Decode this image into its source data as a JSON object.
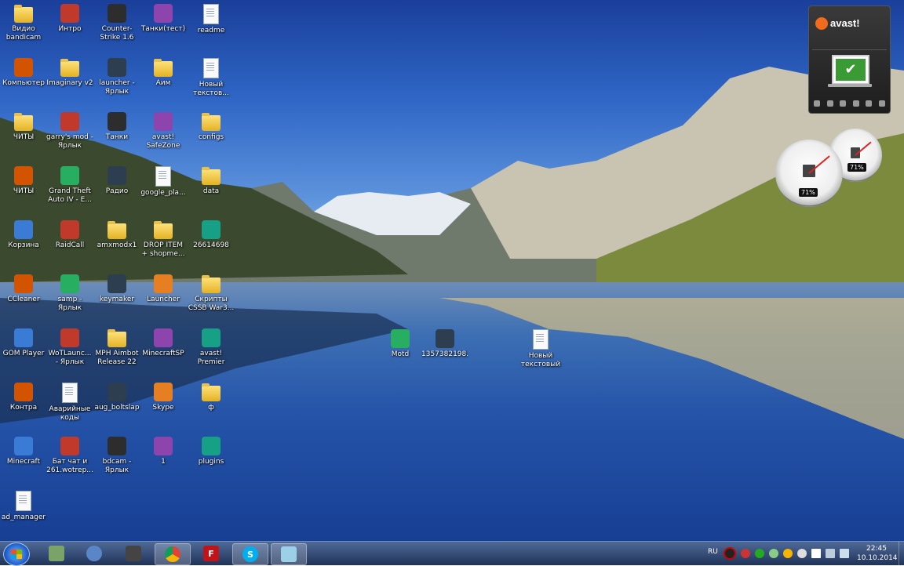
{
  "desktop_icons": [
    {
      "label": "Видио bandicam",
      "type": "folder"
    },
    {
      "label": "Интро",
      "type": "app"
    },
    {
      "label": "Counter-Strike 1.6",
      "type": "app"
    },
    {
      "label": "Танки(тест)",
      "type": "app"
    },
    {
      "label": "readme",
      "type": "doc"
    },
    {
      "label": "Компьютер",
      "type": "app"
    },
    {
      "label": "Imaginary v2",
      "type": "folder"
    },
    {
      "label": "launcher - Ярлык",
      "type": "app"
    },
    {
      "label": "Аим",
      "type": "folder"
    },
    {
      "label": "Новый текстов...",
      "type": "doc"
    },
    {
      "label": "ЧИТЫ",
      "type": "folder"
    },
    {
      "label": "garry's mod - Ярлык",
      "type": "app"
    },
    {
      "label": "Танки",
      "type": "app"
    },
    {
      "label": "avast! SafeZone",
      "type": "app"
    },
    {
      "label": "configs",
      "type": "folder"
    },
    {
      "label": "ЧИТЫ",
      "type": "app"
    },
    {
      "label": "Grand Theft Auto IV - E...",
      "type": "app"
    },
    {
      "label": "Радио",
      "type": "app"
    },
    {
      "label": "google_pla...",
      "type": "doc"
    },
    {
      "label": "data",
      "type": "folder"
    },
    {
      "label": "Корзина",
      "type": "app"
    },
    {
      "label": "RaidCall",
      "type": "app"
    },
    {
      "label": "amxmodx1",
      "type": "folder"
    },
    {
      "label": "DROP ITEM + shopme...",
      "type": "folder"
    },
    {
      "label": "26614698",
      "type": "app"
    },
    {
      "label": "CCleaner",
      "type": "app"
    },
    {
      "label": "samp - Ярлык",
      "type": "app"
    },
    {
      "label": "keymaker",
      "type": "app"
    },
    {
      "label": "Launcher",
      "type": "app"
    },
    {
      "label": "Скрипты CSSB War3...",
      "type": "folder"
    },
    {
      "label": "GOM Player",
      "type": "app"
    },
    {
      "label": "WoTLaunc... - Ярлык",
      "type": "app"
    },
    {
      "label": "MPH Aimbot Release 22",
      "type": "folder"
    },
    {
      "label": "MinecraftSP",
      "type": "app"
    },
    {
      "label": "avast! Premier",
      "type": "app"
    },
    {
      "label": "Контра",
      "type": "app"
    },
    {
      "label": "Аварийные коды",
      "type": "doc"
    },
    {
      "label": "aug_boltslap",
      "type": "app"
    },
    {
      "label": "Skype",
      "type": "app"
    },
    {
      "label": "ф",
      "type": "folder"
    },
    {
      "label": "Minecraft",
      "type": "app"
    },
    {
      "label": "Бат чат и 261.wotrep...",
      "type": "app"
    },
    {
      "label": "bdcam - Ярлык",
      "type": "app"
    },
    {
      "label": "1",
      "type": "app"
    },
    {
      "label": "plugins",
      "type": "app"
    },
    {
      "label": "ad_manager",
      "type": "doc"
    },
    {
      "label": "Motd",
      "type": "app"
    },
    {
      "label": "1357382198...",
      "type": "app"
    },
    {
      "label": "Новый текстовый ...",
      "type": "doc"
    }
  ],
  "avast_widget": {
    "brand": "avast!",
    "status_icon": "checkmark-icon"
  },
  "gauges": [
    {
      "value": "71%"
    },
    {
      "value": "71%"
    }
  ],
  "taskbar": {
    "items": [
      "start-button",
      "explorer",
      "speakers",
      "world-of-tanks",
      "chrome",
      "filezilla",
      "skype",
      "aero-window"
    ],
    "language": "RU",
    "time": "22:45",
    "date": "10.10.2014"
  },
  "colors": {
    "avast_orange": "#f26b1d",
    "check_green": "#3a9a34",
    "taskbar": "#1e3a6a"
  }
}
